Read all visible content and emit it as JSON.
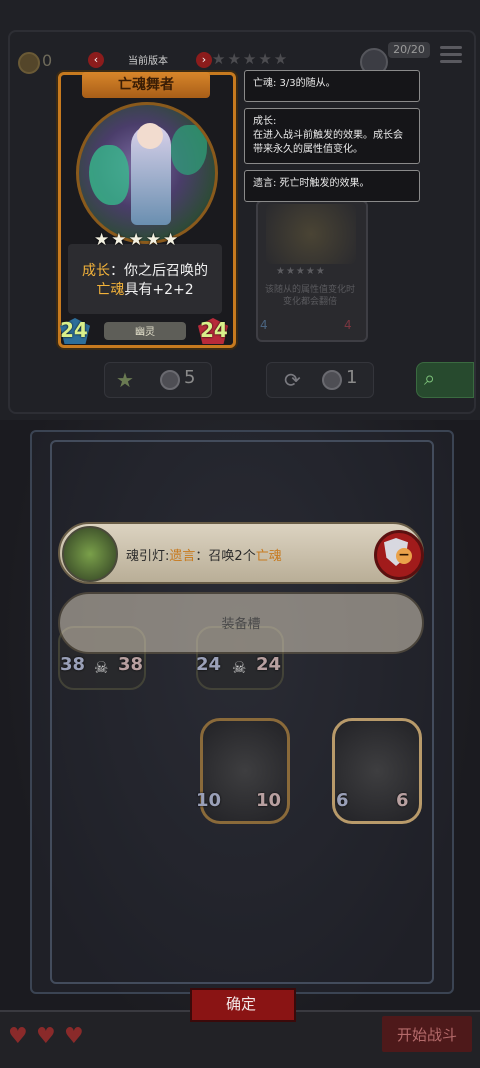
{
  "header": {
    "gold": "0",
    "version_title": "当前版本",
    "prev_icon": "chevron-left-icon",
    "next_icon": "chevron-right-icon",
    "stars": "★★★★★",
    "count_badge": "20/20"
  },
  "featured_card": {
    "name": "亡魂舞者",
    "stars": "★★★★★",
    "desc_line1_keyword": "成长",
    "desc_line1_rest": "：你之后召唤的",
    "desc_line2_keyword": "亡魂",
    "desc_line2_rest": "具有+2+2",
    "attack": "24",
    "health": "24",
    "tribe": "幽灵"
  },
  "secondary_card": {
    "stars": "★★★★★",
    "desc_line1": "该随从的属性值变化时",
    "desc_line2": "变化都会翻倍",
    "attack": "4",
    "health": "4"
  },
  "tooltips": [
    "亡魂: 3/3的随从。",
    "成长:\n在进入战斗前触发的效果。成长会带来永久的属性值变化。",
    "遗言: 死亡时触发的效果。"
  ],
  "filters": {
    "star_count": "5",
    "refresh_count": "1"
  },
  "board": {
    "row1": [
      {
        "attack": "38",
        "health": "38"
      },
      {
        "attack": "24",
        "health": "24"
      }
    ],
    "row2": [
      {
        "attack": "10",
        "health": "10"
      },
      {
        "attack": "6",
        "health": "6"
      }
    ]
  },
  "selected_item": {
    "name": "魂引灯",
    "sep": ":",
    "keyword": "遗言",
    "colon": "：召唤2个",
    "keyword2": "亡魂"
  },
  "slot_label": "装备槽",
  "confirm_label": "确定",
  "start_label": "开始战斗",
  "lives": [
    "♥",
    "♥",
    "♥"
  ]
}
